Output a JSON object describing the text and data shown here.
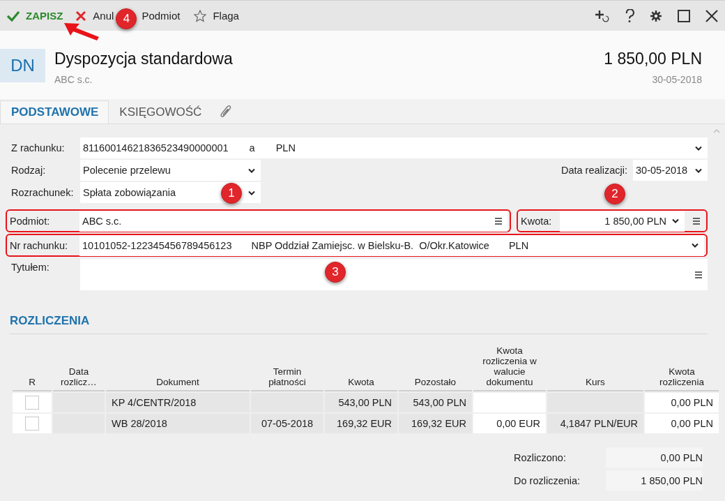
{
  "toolbar": {
    "actions": [
      {
        "kind": "save",
        "label": "ZAPISZ",
        "arrow": true
      },
      {
        "kind": "cancel",
        "label": "Anul",
        "callout": "4"
      },
      {
        "kind": "entity",
        "label": "Podmiot"
      },
      {
        "kind": "flag",
        "label": "Flaga"
      }
    ]
  },
  "document": {
    "badge": "DN",
    "title": "Dyspozycja standardowa",
    "subtitle": "ABC s.c.",
    "amount": "1 850,00 PLN",
    "date": "30-05-2018"
  },
  "tabs": [
    {
      "label": "PODSTAWOWE",
      "selected": true
    },
    {
      "label": "KSIĘGOWOŚĆ",
      "selected": false
    }
  ],
  "form": {
    "from_account": {
      "label": "Z rachunku:",
      "parts": [
        "81160014621836523490000001",
        "a",
        "PLN"
      ]
    },
    "type": {
      "label": "Rodzaj:",
      "value": "Polecenie przelewu"
    },
    "execution_date": {
      "label": "Data realizacji:",
      "value": "30-05-2018",
      "callout": "2"
    },
    "settlement": {
      "label": "Rozrachunek:",
      "value": "Spłata zobowiązania",
      "callout": "1"
    },
    "entity": {
      "label": "Podmiot:",
      "value": "ABC s.c.",
      "highlighted": true
    },
    "amount": {
      "label": "Kwota:",
      "value": "1 850,00 PLN",
      "highlighted": true
    },
    "account_no": {
      "label": "Nr rachunku:",
      "parts": [
        "10101052-122345456789456123",
        "NBP Oddział Zamiejsc. w Bielsku-B.  O/Okr.Katowice",
        "PLN"
      ],
      "highlighted": true,
      "callout": "3"
    },
    "title": {
      "label": "Tytułem:"
    }
  },
  "settlements": {
    "title": "ROZLICZENIA",
    "columns": [
      {
        "label": "R",
        "editable": true
      },
      {
        "label": "Data rozlicz…",
        "editable": false
      },
      {
        "label": "Dokument",
        "editable": false
      },
      {
        "label": "Termin płatności",
        "editable": false
      },
      {
        "label": "Kwota",
        "editable": false
      },
      {
        "label": "Pozostało",
        "editable": false
      },
      {
        "label": "Kwota rozliczenia w walucie dokumentu",
        "editable": true
      },
      {
        "label": "Kurs",
        "editable": false
      },
      {
        "label": "Kwota rozliczenia",
        "editable": true
      }
    ],
    "rows": [
      {
        "checked": false,
        "cells": [
          "",
          "",
          "KP 4/CENTR/2018",
          "",
          "543,00 PLN",
          "543,00 PLN",
          "",
          "",
          "0,00 PLN"
        ]
      },
      {
        "checked": false,
        "cells": [
          "",
          "",
          "WB 28/2018",
          "07-05-2018",
          "169,32 EUR",
          "169,32 EUR",
          "0,00 EUR",
          "4,1847 PLN/EUR",
          "0,00 PLN"
        ]
      }
    ]
  },
  "summary": [
    {
      "label": "Rozliczono:",
      "value": "0,00 PLN"
    },
    {
      "label": "Do rozliczenia:",
      "value": "1 850,00 PLN"
    }
  ]
}
